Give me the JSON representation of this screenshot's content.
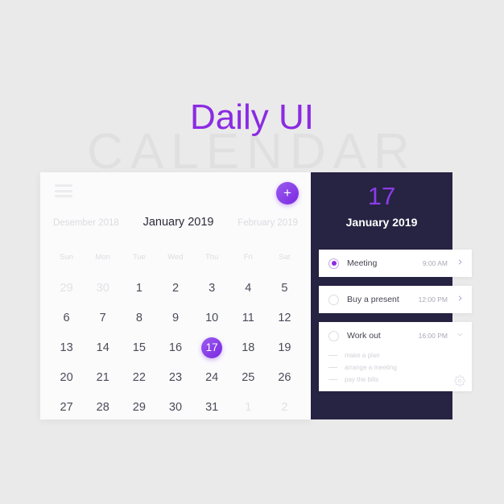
{
  "page": {
    "title": "Daily UI",
    "watermark": "CALENDAR",
    "background_color": "#eaeaea",
    "accent_color": "#8b2be2",
    "panel_dark_color": "#272343"
  },
  "calendar": {
    "menu_icon": "hamburger-icon",
    "add_button_label": "+",
    "prev_month": "Desember 2018",
    "current_month": "January 2019",
    "next_month": "February 2019",
    "weekdays": [
      "Sun",
      "Mon",
      "Tue",
      "Wed",
      "Thu",
      "Fri",
      "Sat"
    ],
    "selected_day": "17",
    "days": [
      {
        "label": "29",
        "state": "muted"
      },
      {
        "label": "30",
        "state": "muted"
      },
      {
        "label": "1",
        "state": "normal"
      },
      {
        "label": "2",
        "state": "normal"
      },
      {
        "label": "3",
        "state": "normal"
      },
      {
        "label": "4",
        "state": "normal"
      },
      {
        "label": "5",
        "state": "normal"
      },
      {
        "label": "6",
        "state": "normal"
      },
      {
        "label": "7",
        "state": "normal"
      },
      {
        "label": "8",
        "state": "normal"
      },
      {
        "label": "9",
        "state": "normal"
      },
      {
        "label": "10",
        "state": "normal"
      },
      {
        "label": "11",
        "state": "normal"
      },
      {
        "label": "12",
        "state": "normal"
      },
      {
        "label": "13",
        "state": "normal"
      },
      {
        "label": "14",
        "state": "normal"
      },
      {
        "label": "15",
        "state": "normal"
      },
      {
        "label": "16",
        "state": "normal"
      },
      {
        "label": "17",
        "state": "selected"
      },
      {
        "label": "18",
        "state": "normal"
      },
      {
        "label": "19",
        "state": "normal"
      },
      {
        "label": "20",
        "state": "normal"
      },
      {
        "label": "21",
        "state": "normal"
      },
      {
        "label": "22",
        "state": "normal"
      },
      {
        "label": "23",
        "state": "normal"
      },
      {
        "label": "24",
        "state": "normal"
      },
      {
        "label": "25",
        "state": "normal"
      },
      {
        "label": "26",
        "state": "normal"
      },
      {
        "label": "27",
        "state": "normal"
      },
      {
        "label": "28",
        "state": "normal"
      },
      {
        "label": "29",
        "state": "normal"
      },
      {
        "label": "30",
        "state": "normal"
      },
      {
        "label": "31",
        "state": "normal"
      },
      {
        "label": "1",
        "state": "muted"
      },
      {
        "label": "2",
        "state": "muted"
      }
    ]
  },
  "detail": {
    "day": "17",
    "month": "January 2019",
    "events": [
      {
        "title": "Meeting",
        "time": "9:00 AM",
        "checked": true,
        "chevron": "chevron-right-icon",
        "expanded": false,
        "subtasks": []
      },
      {
        "title": "Buy a present",
        "time": "12:00 PM",
        "checked": false,
        "chevron": "chevron-right-icon",
        "expanded": false,
        "subtasks": []
      },
      {
        "title": "Work out",
        "time": "16:00 PM",
        "checked": false,
        "chevron": "chevron-down-icon",
        "expanded": true,
        "subtasks": [
          "make a plan",
          "arrange a meeting",
          "pay the bills"
        ]
      }
    ],
    "settings_icon": "gear-icon"
  }
}
